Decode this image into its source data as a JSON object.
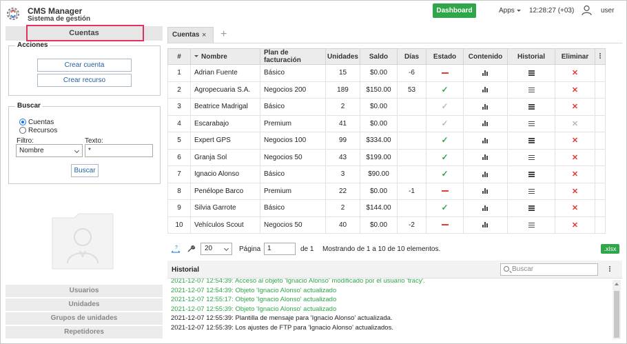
{
  "header": {
    "title": "CMS Manager",
    "subtitle": "Sistema de gestión",
    "dashboard_label": "Dashboard",
    "apps_label": "Apps",
    "clock": "12:28:27 (+03)",
    "user": "user",
    "accent": "#2fa64a"
  },
  "left": {
    "tab": "Cuentas",
    "acciones": {
      "legend": "Acciones",
      "crear_cuenta": "Crear cuenta",
      "crear_recurso": "Crear recurso"
    },
    "buscar": {
      "legend": "Buscar",
      "radio_cuentas": "Cuentas",
      "radio_recursos": "Recursos",
      "filtro_label": "Filtro:",
      "filtro_value": "Nombre",
      "texto_label": "Texto:",
      "texto_value": "*",
      "button": "Buscar"
    },
    "bottom_items": [
      "Usuarios",
      "Unidades",
      "Grupos de unidades",
      "Repetidores"
    ]
  },
  "tabs": {
    "active": "Cuentas",
    "close": "×",
    "add": "+"
  },
  "table": {
    "headers": [
      "#",
      "Nombre",
      "Plan de facturación",
      "Unidades",
      "Saldo",
      "Días",
      "Estado",
      "Contenido",
      "Historial",
      "Eliminar"
    ],
    "rows": [
      {
        "n": "1",
        "name": "Adrian Fuente",
        "plan": "Básico",
        "units": "15",
        "saldo": "$0.00",
        "dias": "-6",
        "estado": "minus",
        "del": "red"
      },
      {
        "n": "2",
        "name": "Agropecuaria S.A.",
        "plan": "Negocios 200",
        "units": "189",
        "saldo": "$150.00",
        "dias": "53",
        "estado": "green",
        "del": "red"
      },
      {
        "n": "3",
        "name": "Beatrice Madrigal",
        "plan": "Básico",
        "units": "2",
        "saldo": "$0.00",
        "dias": "",
        "estado": "grey",
        "del": "red"
      },
      {
        "n": "4",
        "name": "Escarabajo",
        "plan": "Premium",
        "units": "41",
        "saldo": "$0.00",
        "dias": "",
        "estado": "grey",
        "del": "grey"
      },
      {
        "n": "5",
        "name": "Expert GPS",
        "plan": "Negocios 100",
        "units": "99",
        "saldo": "$334.00",
        "dias": "",
        "estado": "green",
        "del": "red"
      },
      {
        "n": "6",
        "name": "Granja Sol",
        "plan": "Negocios 50",
        "units": "43",
        "saldo": "$199.00",
        "dias": "",
        "estado": "green",
        "del": "red"
      },
      {
        "n": "7",
        "name": "Ignacio Alonso",
        "plan": "Básico",
        "units": "3",
        "saldo": "$90.00",
        "dias": "",
        "estado": "green",
        "del": "red"
      },
      {
        "n": "8",
        "name": "Penélope Barco",
        "plan": "Premium",
        "units": "22",
        "saldo": "$0.00",
        "dias": "-1",
        "estado": "minus",
        "del": "red"
      },
      {
        "n": "9",
        "name": "Silvia Garrote",
        "plan": "Básico",
        "units": "2",
        "saldo": "$144.00",
        "dias": "",
        "estado": "green",
        "del": "red"
      },
      {
        "n": "10",
        "name": "Vehículos Scout",
        "plan": "Negocios 50",
        "units": "40",
        "saldo": "$0.00",
        "dias": "-2",
        "estado": "minus",
        "del": "red"
      }
    ]
  },
  "pager": {
    "page_size": "20",
    "page_label": "Página",
    "page_value": "1",
    "of_label": "de 1",
    "summary": "Mostrando de 1 a 10 de 10 elementos.",
    "export": ".xlsx"
  },
  "history": {
    "title": "Historial",
    "search_placeholder": "Buscar",
    "lines": [
      {
        "text": "2021-12-07 12:54:39: Acceso al objeto 'Ignacio Alonso' modificado por el usuario 'tracy'.",
        "color": "g"
      },
      {
        "text": "2021-12-07 12:54:39: Objeto 'Ignacio Alonso' actualizado",
        "color": "g"
      },
      {
        "text": "2021-12-07 12:55:17: Objeto 'Ignacio Alonso' actualizado",
        "color": "g"
      },
      {
        "text": "2021-12-07 12:55:39: Objeto 'Ignacio Alonso' actualizado",
        "color": "g"
      },
      {
        "text": "2021-12-07 12:55:39: Plantilla de mensaje para 'Ignacio Alonso' actualizada.",
        "color": "k"
      },
      {
        "text": "2021-12-07 12:55:39: Los ajustes de FTP para 'Ignacio Alonso' actualizados.",
        "color": "k"
      }
    ]
  }
}
